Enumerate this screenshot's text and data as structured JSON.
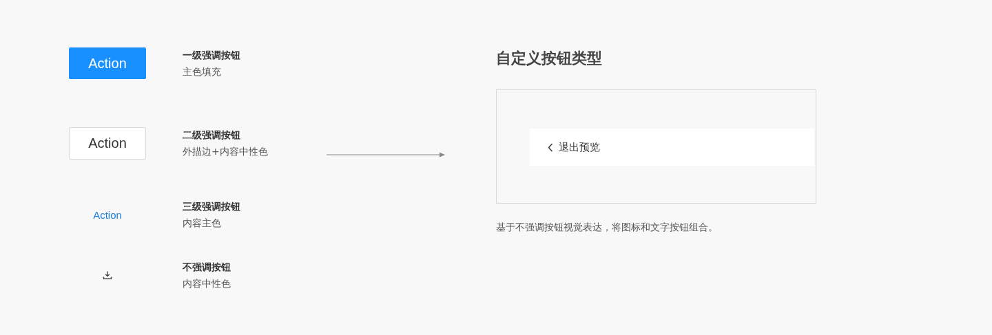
{
  "button_types": [
    {
      "kind": "primary",
      "label": "Action",
      "title": "一级强调按钮",
      "description": "主色填充"
    },
    {
      "kind": "secondary",
      "label": "Action",
      "title": "二级强调按钮",
      "description": "外描边+内容中性色"
    },
    {
      "kind": "text",
      "label": "Action",
      "title": "三级强调按钮",
      "description": "内容主色"
    },
    {
      "kind": "icon",
      "title": "不强调按钮",
      "description": "内容中性色"
    }
  ],
  "custom": {
    "title": "自定义按钮类型",
    "preview_button": {
      "label": "退出预览"
    },
    "caption": "基于不强调按钮视觉表达，将图标和文字按钮组合。"
  }
}
